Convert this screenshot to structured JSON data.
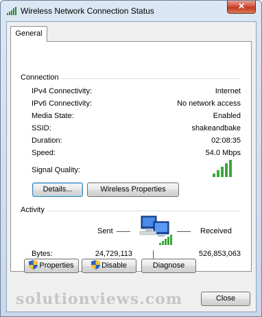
{
  "window": {
    "title": "Wireless Network Connection Status",
    "close_glyph": "✕"
  },
  "tabs": [
    {
      "label": "General",
      "selected": true
    }
  ],
  "connection": {
    "group_label": "Connection",
    "rows": [
      {
        "label": "IPv4 Connectivity:",
        "value": "Internet"
      },
      {
        "label": "IPv6 Connectivity:",
        "value": "No network access"
      },
      {
        "label": "Media State:",
        "value": "Enabled"
      },
      {
        "label": "SSID:",
        "value": "shakeandbake"
      },
      {
        "label": "Duration:",
        "value": "02:08:35"
      },
      {
        "label": "Speed:",
        "value": "54.0 Mbps"
      }
    ],
    "signal_label": "Signal Quality:",
    "signal_bars_lit": 5,
    "signal_bars_total": 5,
    "details_button": "Details...",
    "wireless_properties_button": "Wireless Properties"
  },
  "activity": {
    "group_label": "Activity",
    "sent_label": "Sent",
    "received_label": "Received",
    "bytes_label": "Bytes:",
    "bytes_sent": "24,729,113",
    "bytes_received": "526,853,063"
  },
  "buttons": {
    "properties": "Properties",
    "disable": "Disable",
    "diagnose": "Diagnose",
    "close": "Close"
  },
  "watermark": "solutionviews.com",
  "colors": {
    "signal_green": "#3aa63a",
    "titlebar": "#c9d8ea",
    "close_red": "#c2381e",
    "default_button_border": "#3c7fb1"
  },
  "icons": {
    "title": "wireless-signal-icon",
    "network": "network-computers-icon",
    "uac": "uac-shield-icon"
  }
}
